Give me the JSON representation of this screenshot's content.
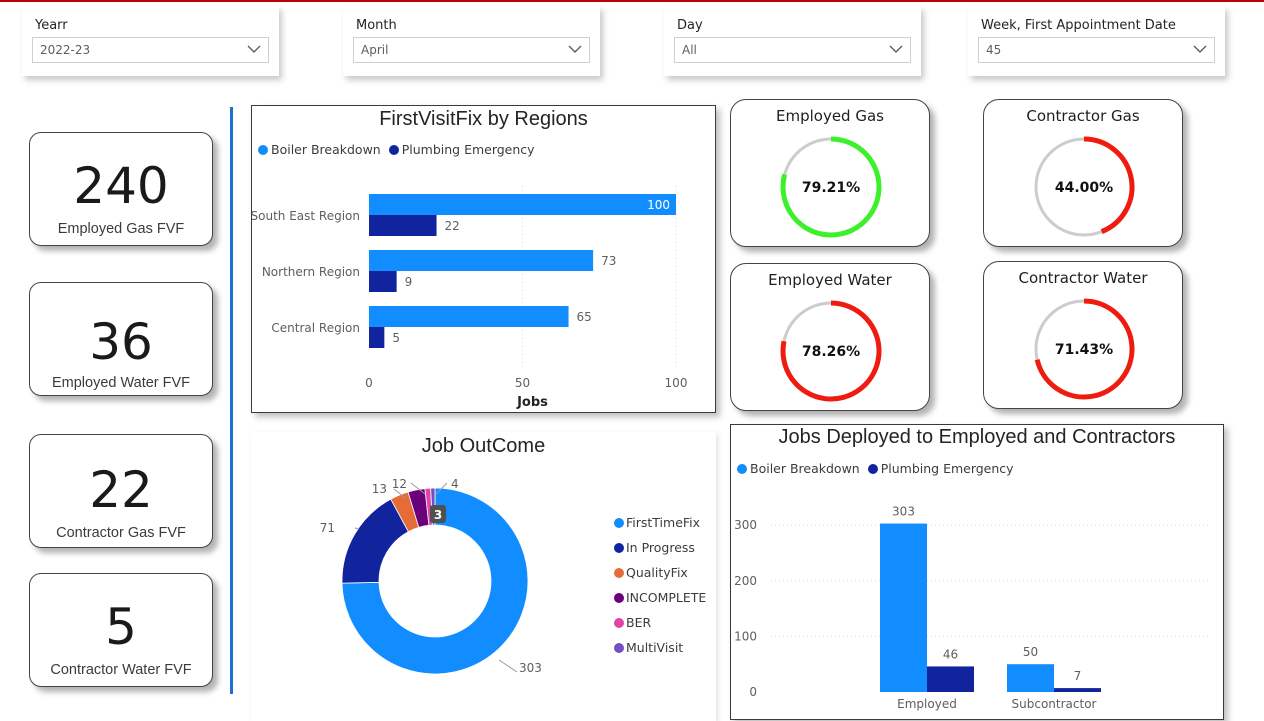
{
  "slicers": [
    {
      "label": "Yearr",
      "value": "2022-23"
    },
    {
      "label": "Month",
      "value": "April"
    },
    {
      "label": "Day",
      "value": "All"
    },
    {
      "label": "Week, First Appointment Date",
      "value": "45"
    }
  ],
  "kpis": [
    {
      "value": "240",
      "caption": "Employed Gas FVF"
    },
    {
      "value": "36",
      "caption": "Employed Water FVF"
    },
    {
      "value": "22",
      "caption": "Contractor Gas FVF"
    },
    {
      "value": "5",
      "caption": "Contractor Water FVF"
    }
  ],
  "colors": {
    "boiler": "#118dff",
    "plumbing": "#12239e",
    "good": "#3cf02a",
    "bad": "#ee1c0e",
    "track": "#cccccc",
    "divider": "#1f6fd1"
  },
  "legend": {
    "boiler": "Boiler Breakdown",
    "plumbing": "Plumbing  Emergency"
  },
  "regions_chart": {
    "title": "FirstVisitFix by Regions",
    "chart_data": {
      "type": "bar",
      "orientation": "horizontal",
      "categories": [
        "South East Region",
        "Northern Region",
        "Central Region"
      ],
      "series": [
        {
          "name": "Boiler Breakdown",
          "values": [
            100,
            73,
            65
          ]
        },
        {
          "name": "Plumbing  Emergency",
          "values": [
            22,
            9,
            5
          ]
        }
      ],
      "xlabel": "Jobs",
      "xticks": [
        "0",
        "50",
        "100"
      ],
      "xlim": [
        0,
        100
      ]
    }
  },
  "gauges": [
    {
      "title": "Employed Gas",
      "value": 79.21,
      "label": "79.21%",
      "status": "good"
    },
    {
      "title": "Contractor Gas",
      "value": 44.0,
      "label": "44.00%",
      "status": "bad"
    },
    {
      "title": "Employed Water",
      "value": 78.26,
      "label": "78.26%",
      "status": "bad"
    },
    {
      "title": "Contractor Water",
      "value": 71.43,
      "label": "71.43%",
      "status": "bad"
    }
  ],
  "outcome_chart": {
    "title": "Job OutCome",
    "chart_data": {
      "type": "pie",
      "donut": true,
      "categories": [
        "FirstTimeFix",
        "In Progress",
        "QualityFix",
        "INCOMPLETE",
        "BER",
        "MultiVisit"
      ],
      "values": [
        303,
        71,
        13,
        12,
        4,
        3
      ],
      "value_labels": [
        "303",
        "71",
        "13",
        "12",
        "4",
        "3"
      ],
      "colors": [
        "#118dff",
        "#12239e",
        "#e66c37",
        "#6b007b",
        "#e044a7",
        "#744ec2"
      ]
    }
  },
  "deployed_chart": {
    "title": "Jobs Deployed to Employed and Contractors",
    "chart_data": {
      "type": "bar",
      "categories": [
        "Employed",
        "Subcontractor"
      ],
      "series": [
        {
          "name": "Boiler Breakdown",
          "values": [
            303,
            50
          ]
        },
        {
          "name": "Plumbing  Emergency",
          "values": [
            46,
            7
          ]
        }
      ],
      "yticks": [
        "0",
        "100",
        "200",
        "300"
      ],
      "ylim": [
        0,
        340
      ]
    }
  }
}
